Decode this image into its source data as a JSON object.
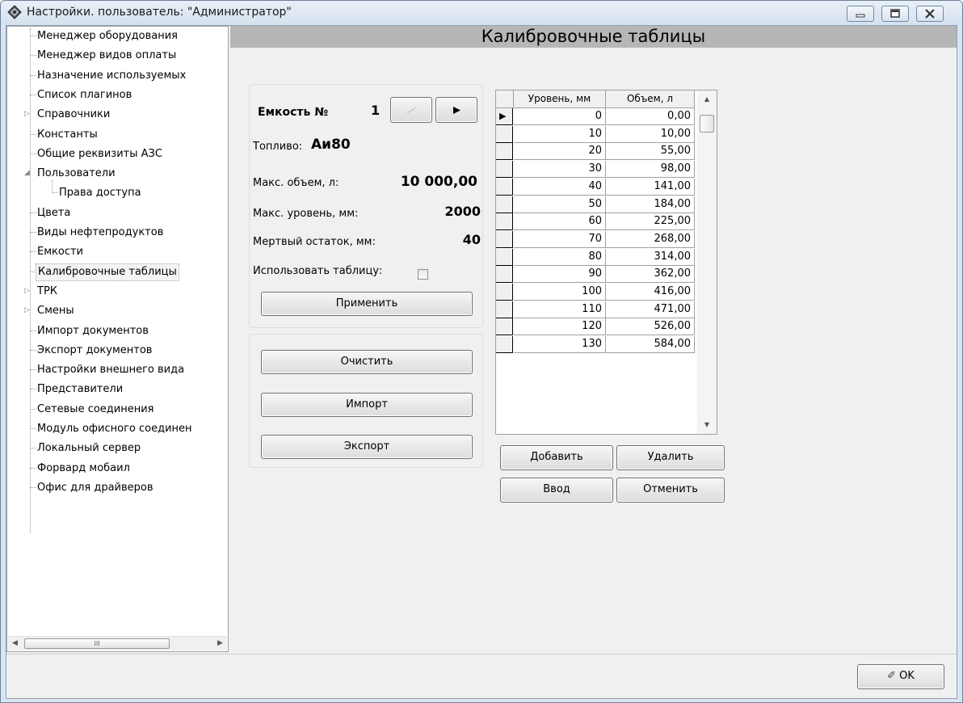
{
  "window": {
    "title": "Настройки. пользователь: \"Администратор\"",
    "controls": {
      "minimize": "—",
      "maximize": "□",
      "close": "✕"
    }
  },
  "tree": {
    "items": [
      {
        "label": "Менеджер оборудования",
        "level": 1,
        "expander": ""
      },
      {
        "label": "Менеджер видов оплаты",
        "level": 1,
        "expander": ""
      },
      {
        "label": "Назначение используемых",
        "level": 1,
        "expander": ""
      },
      {
        "label": "Список плагинов",
        "level": 1,
        "expander": ""
      },
      {
        "label": "Справочники",
        "level": 1,
        "expander": "▷"
      },
      {
        "label": "Константы",
        "level": 1,
        "expander": ""
      },
      {
        "label": "Общие реквизиты АЗС",
        "level": 1,
        "expander": ""
      },
      {
        "label": "Пользователи",
        "level": 1,
        "expander": "◢"
      },
      {
        "label": "Права доступа",
        "level": 2,
        "expander": ""
      },
      {
        "label": "Цвета",
        "level": 1,
        "expander": ""
      },
      {
        "label": "Виды нефтепродуктов",
        "level": 1,
        "expander": ""
      },
      {
        "label": "Емкости",
        "level": 1,
        "expander": ""
      },
      {
        "label": "Калибровочные таблицы",
        "level": 1,
        "expander": "",
        "selected": true
      },
      {
        "label": "ТРК",
        "level": 1,
        "expander": "▷"
      },
      {
        "label": "Смены",
        "level": 1,
        "expander": "▷"
      },
      {
        "label": "Импорт документов",
        "level": 1,
        "expander": ""
      },
      {
        "label": "Экспорт документов",
        "level": 1,
        "expander": ""
      },
      {
        "label": "Настройки внешнего вида",
        "level": 1,
        "expander": ""
      },
      {
        "label": "Представители",
        "level": 1,
        "expander": ""
      },
      {
        "label": "Сетевые соединения",
        "level": 1,
        "expander": ""
      },
      {
        "label": "Модуль офисного соединен",
        "level": 1,
        "expander": ""
      },
      {
        "label": "Локальный сервер",
        "level": 1,
        "expander": ""
      },
      {
        "label": "Форвард мобаил",
        "level": 1,
        "expander": ""
      },
      {
        "label": "Офис для драйверов",
        "level": 1,
        "expander": ""
      }
    ],
    "scroll": {
      "left_arrow": "◀",
      "right_arrow": "▶",
      "grip": "III"
    }
  },
  "header": {
    "title": "Калибровочные таблицы"
  },
  "tank": {
    "label": "Емкость №",
    "number": "1",
    "prev_glyph": "◀",
    "next_glyph": "▶",
    "fuel_label": "Топливо:",
    "fuel_value": "Аи80",
    "max_volume_label": "Макс. объем, л:",
    "max_volume_value": "10 000,00",
    "max_level_label": "Макс. уровень, мм:",
    "max_level_value": "2000",
    "dead_label": "Мертвый остаток, мм:",
    "dead_value": "40",
    "use_table_label": "Использовать таблицу:",
    "use_table_checked": false,
    "apply_label": "Применить"
  },
  "actions": {
    "clear": "Очистить",
    "import": "Импорт",
    "export": "Экспорт"
  },
  "grid": {
    "columns": [
      "Уровень, мм",
      "Объем, л"
    ],
    "current_row_marker": "▶",
    "rows": [
      [
        "0",
        "0,00"
      ],
      [
        "10",
        "10,00"
      ],
      [
        "20",
        "55,00"
      ],
      [
        "30",
        "98,00"
      ],
      [
        "40",
        "141,00"
      ],
      [
        "50",
        "184,00"
      ],
      [
        "60",
        "225,00"
      ],
      [
        "70",
        "268,00"
      ],
      [
        "80",
        "314,00"
      ],
      [
        "90",
        "362,00"
      ],
      [
        "100",
        "416,00"
      ],
      [
        "110",
        "471,00"
      ],
      [
        "120",
        "526,00"
      ],
      [
        "130",
        "584,00"
      ]
    ],
    "scroll": {
      "up": "▲",
      "down": "▼"
    }
  },
  "grid_buttons": {
    "add": "Добавить",
    "delete": "Удалить",
    "enter": "Ввод",
    "cancel": "Отменить"
  },
  "footer": {
    "ok_label": "OK",
    "ok_icon": "✐"
  }
}
